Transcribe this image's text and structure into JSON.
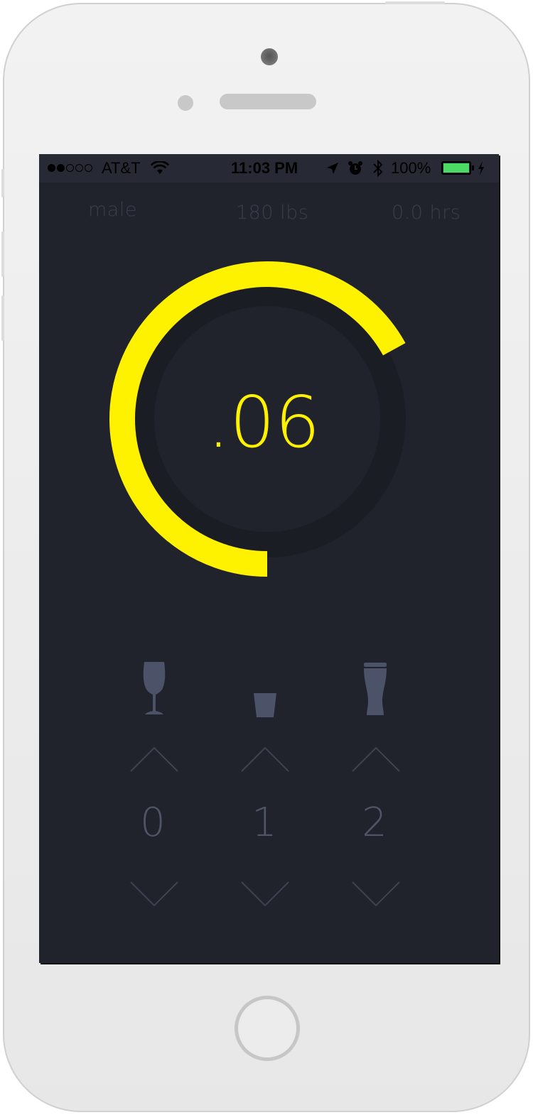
{
  "status_bar": {
    "carrier": "AT&T",
    "time": "11:03 PM",
    "battery": "100%",
    "signal_bars": 2,
    "signal_total": 5
  },
  "settings": {
    "gender": "male",
    "weight": "180 lbs",
    "hours": "0.0 hrs"
  },
  "bac": {
    "value_label": ".06",
    "ring_fraction": 0.67,
    "ring_color": "#fff200",
    "track_color": "#1b1d24"
  },
  "drinks": [
    {
      "icon": "wine-glass-icon",
      "count": "0"
    },
    {
      "icon": "shot-glass-icon",
      "count": "1"
    },
    {
      "icon": "beer-glass-icon",
      "count": "2"
    }
  ],
  "colors": {
    "screen_bg": "#20232c",
    "accent": "#fff200",
    "muted": "#4f5466",
    "icon": "#4c5268"
  }
}
